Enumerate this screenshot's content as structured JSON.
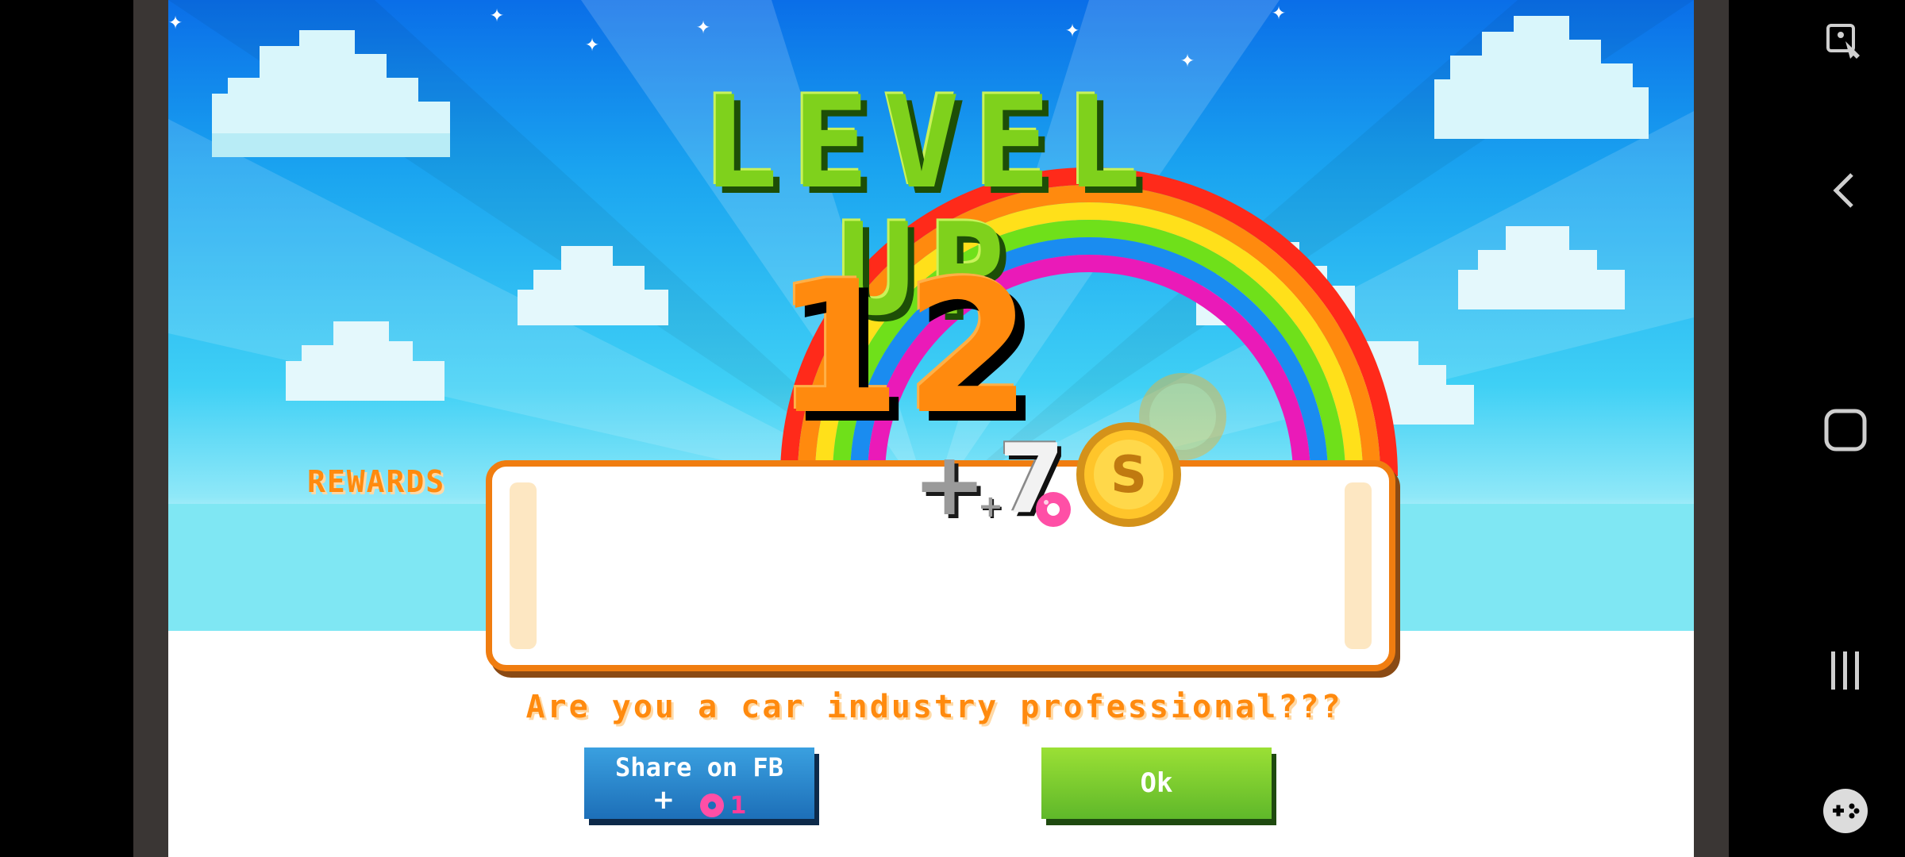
{
  "game": {
    "title": "LEVEL UP",
    "level_number": "12",
    "rewards_label": "REWARDS",
    "reward_amount": "7",
    "question": "Are you a car industry professional???",
    "share_button": {
      "label": "Share on FB",
      "reward_count": "1"
    },
    "ok_button": {
      "label": "Ok"
    }
  },
  "system_nav": {
    "icons": [
      "accessibility-icon",
      "back-icon",
      "home-icon",
      "recents-icon",
      "game-tools-icon"
    ]
  },
  "colors": {
    "accent_orange": "#ff8a0e",
    "title_green": "#7fd11c",
    "share_blue": "#1d6fb8",
    "ok_green": "#5fb82a"
  }
}
